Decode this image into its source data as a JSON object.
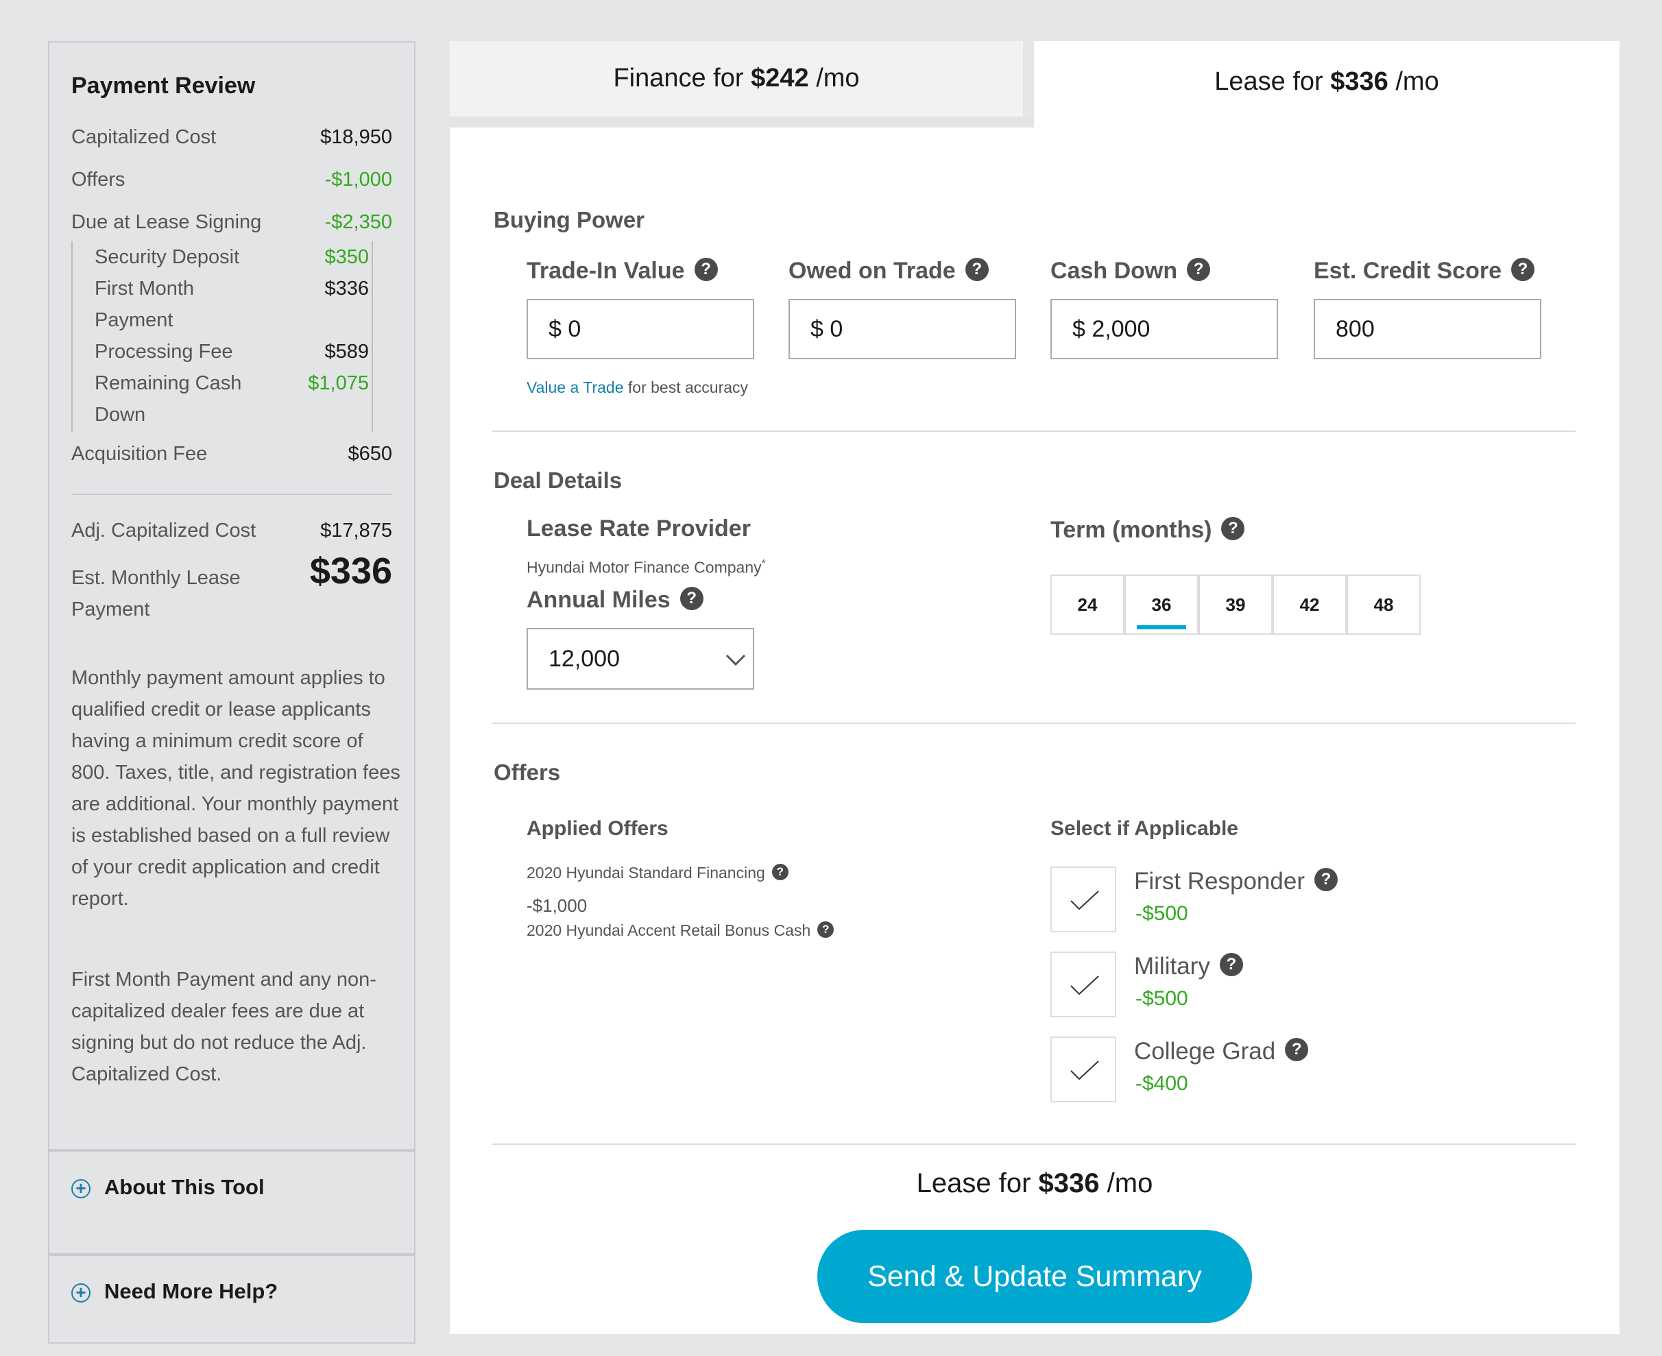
{
  "sidebar": {
    "title": "Payment Review",
    "capitalized_cost": {
      "label": "Capitalized Cost",
      "value": "$18,950"
    },
    "offers": {
      "label": "Offers",
      "value": "-$1,000"
    },
    "due_at_signing": {
      "label": "Due at Lease Signing",
      "value": "-$2,350"
    },
    "security_deposit": {
      "label": "Security Deposit",
      "value": "$350"
    },
    "first_month": {
      "label_line1": "First Month",
      "label_line2": "Payment",
      "value": "$336"
    },
    "processing_fee": {
      "label": "Processing Fee",
      "value": "$589"
    },
    "remaining_cash": {
      "label_line1": "Remaining Cash",
      "label_line2": "Down",
      "value": "$1,075"
    },
    "acquisition_fee": {
      "label": "Acquisition Fee",
      "value": "$650"
    },
    "adj_cap_cost": {
      "label": "Adj. Capitalized Cost",
      "value": "$17,875"
    },
    "est_monthly": {
      "label_line1": "Est. Monthly Lease",
      "label_line2": "Payment",
      "value": "$336"
    },
    "disclaimer_1": "Monthly payment amount applies to qualified credit or lease applicants having a minimum credit score of 800.  Taxes, title, and registration fees are additional. Your monthly payment is established based on a full review of your credit application and credit report.",
    "disclaimer_2": "First Month Payment and any non-capitalized dealer fees are due at signing but do not reduce the Adj. Capitalized Cost.",
    "accordion_about": "About This Tool",
    "accordion_help": "Need More Help?"
  },
  "tabs": {
    "finance": {
      "prefix": "Finance for",
      "amount": "$242",
      "suffix": "/mo"
    },
    "lease": {
      "prefix": "Lease for",
      "amount": "$336",
      "suffix": "/mo"
    }
  },
  "buying_power": {
    "title": "Buying Power",
    "trade_in": {
      "label": "Trade-In Value",
      "value": "$ 0"
    },
    "owed": {
      "label": "Owed on Trade",
      "value": "$ 0"
    },
    "cash_down": {
      "label": "Cash Down",
      "value": "$ 2,000"
    },
    "credit": {
      "label": "Est. Credit Score",
      "value": "800"
    },
    "value_trade_link": "Value a Trade",
    "value_trade_suffix": "for best accuracy"
  },
  "deal_details": {
    "title": "Deal Details",
    "provider_label": "Lease Rate Provider",
    "provider_name": "Hyundai Motor Finance Company",
    "asterisk": "*",
    "miles_label": "Annual Miles",
    "miles_value": "12,000",
    "term_label": "Term (months)",
    "terms": [
      "24",
      "36",
      "39",
      "42",
      "48"
    ],
    "selected_term": "36"
  },
  "offers_section": {
    "title": "Offers",
    "applied_label": "Applied Offers",
    "applied": [
      {
        "name": "2020 Hyundai Standard Financing"
      },
      {
        "amount": "-$1,000",
        "name": "2020 Hyundai Accent Retail Bonus Cash"
      }
    ],
    "select_label": "Select if Applicable",
    "options": [
      {
        "label": "First Responder",
        "value": "-$500"
      },
      {
        "label": "Military",
        "value": "-$500"
      },
      {
        "label": "College Grad",
        "value": "-$400"
      }
    ]
  },
  "footer": {
    "lease_prefix": "Lease for",
    "lease_amount": "$336",
    "lease_suffix": "/mo",
    "button": "Send & Update Summary"
  },
  "colors": {
    "accent": "#00a8d0",
    "link": "#1a7fa8",
    "positive": "#33a821"
  }
}
